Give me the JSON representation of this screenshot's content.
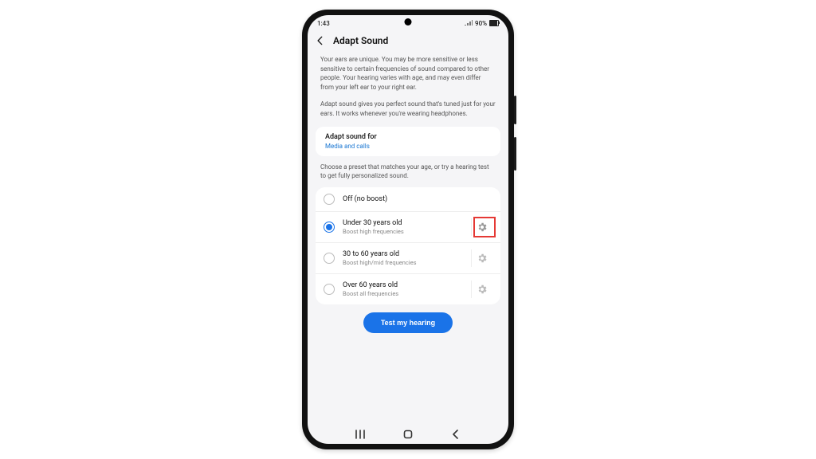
{
  "status": {
    "time": "1:43",
    "battery_pct": "90%"
  },
  "header": {
    "title": "Adapt Sound"
  },
  "intro": {
    "p1": "Your ears are unique. You may be more sensitive or less sensitive to certain frequencies of sound compared to other people. Your hearing varies with age, and may even differ from your left ear to your right ear.",
    "p2": "Adapt sound gives you perfect sound that's tuned just for your ears. It works whenever you're wearing headphones."
  },
  "adapt_for": {
    "label": "Adapt sound for",
    "value": "Media and calls"
  },
  "preset_hint": "Choose a preset that matches your age, or try a hearing test to get fully personalized sound.",
  "options": [
    {
      "label": "Off (no boost)",
      "sub": "",
      "selected": false,
      "gear": false,
      "highlight": false
    },
    {
      "label": "Under 30 years old",
      "sub": "Boost high frequencies",
      "selected": true,
      "gear": true,
      "highlight": true
    },
    {
      "label": "30 to 60 years old",
      "sub": "Boost high/mid frequencies",
      "selected": false,
      "gear": true,
      "highlight": false
    },
    {
      "label": "Over 60 years old",
      "sub": "Boost all frequencies",
      "selected": false,
      "gear": true,
      "highlight": false
    }
  ],
  "cta": {
    "label": "Test my hearing"
  }
}
